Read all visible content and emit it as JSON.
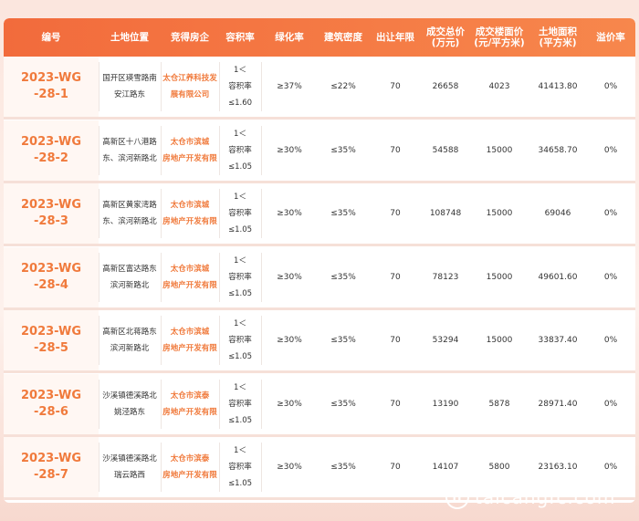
{
  "header": {
    "code": "编号",
    "location": "土地位置",
    "winner": "竞得房企",
    "far": "容积率",
    "green": "绿化率",
    "density": "建筑密度",
    "years": "出让年限",
    "total_price": "成交总价\n(万元)",
    "floor_price": "成交楼面价\n(元/平方米)",
    "area": "土地面积\n(平方米)",
    "premium": "溢价率"
  },
  "rows": [
    {
      "code": "2023-WG\n-28-1",
      "location": "国开区瑛雪路南\n安江路东",
      "winner": "太仓江养科技发\n展有限公司",
      "far": "1＜\n容积率\n≤1.60",
      "green": "≥37%",
      "density": "≤22%",
      "years": "70",
      "total_price": "26658",
      "floor_price": "4023",
      "area": "41413.80",
      "premium": "0%"
    },
    {
      "code": "2023-WG\n-28-2",
      "location": "高新区十八港路\n东、滨河新路北",
      "winner": "太仓市滨城\n房地产开发有限",
      "far": "1＜\n容积率\n≤1.05",
      "green": "≥30%",
      "density": "≤35%",
      "years": "70",
      "total_price": "54588",
      "floor_price": "15000",
      "area": "34658.70",
      "premium": "0%"
    },
    {
      "code": "2023-WG\n-28-3",
      "location": "高新区黄家湾路\n东、滨河新路北",
      "winner": "太仓市滨城\n房地产开发有限",
      "far": "1＜\n容积率\n≤1.05",
      "green": "≥30%",
      "density": "≤35%",
      "years": "70",
      "total_price": "108748",
      "floor_price": "15000",
      "area": "69046",
      "premium": "0%"
    },
    {
      "code": "2023-WG\n-28-4",
      "location": "高新区富达路东\n滨河新路北",
      "winner": "太仓市滨城\n房地产开发有限",
      "far": "1＜\n容积率\n≤1.05",
      "green": "≥30%",
      "density": "≤35%",
      "years": "70",
      "total_price": "78123",
      "floor_price": "15000",
      "area": "49601.60",
      "premium": "0%"
    },
    {
      "code": "2023-WG\n-28-5",
      "location": "高新区北蒋路东\n滨河新路北",
      "winner": "太仓市滨城\n房地产开发有限",
      "far": "1＜\n容积率\n≤1.05",
      "green": "≥30%",
      "density": "≤35%",
      "years": "70",
      "total_price": "53294",
      "floor_price": "15000",
      "area": "33837.40",
      "premium": "0%"
    },
    {
      "code": "2023-WG\n-28-6",
      "location": "沙溪镇德溪路北\n姚泾路东",
      "winner": "太仓市滨泰\n房地产开发有限",
      "far": "1＜\n容积率\n≤1.05",
      "green": "≥30%",
      "density": "≤35%",
      "years": "70",
      "total_price": "13190",
      "floor_price": "5878",
      "area": "28971.40",
      "premium": "0%"
    },
    {
      "code": "2023-WG\n-28-7",
      "location": "沙溪镇德溪路北\n瑞云路西",
      "winner": "太仓市滨泰\n房地产开发有限",
      "far": "1＜\n容积率\n≤1.05",
      "green": "≥30%",
      "density": "≤35%",
      "years": "70",
      "total_price": "14107",
      "floor_price": "5800",
      "area": "23163.10",
      "premium": "0%"
    }
  ],
  "footer": {
    "logo_glyph": "H",
    "site": "taicangfc.com"
  },
  "colors": {
    "header_start": "#f26b3c",
    "header_end": "#f7874c",
    "accent_text": "#f07a3c"
  }
}
